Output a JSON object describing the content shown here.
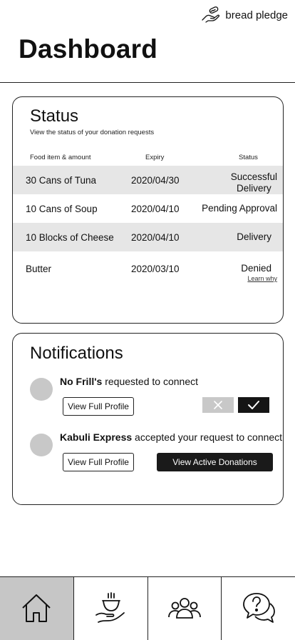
{
  "brand": {
    "name": "bread pledge",
    "icon": "hand-bread-icon"
  },
  "page": {
    "title": "Dashboard"
  },
  "status": {
    "title": "Status",
    "subtitle": "View the status of your donation requests",
    "columns": {
      "food": "Food item & amount",
      "expiry": "Expiry",
      "status": "Status"
    },
    "rows": [
      {
        "food": "30 Cans of Tuna",
        "expiry": "2020/04/30",
        "status_line1": "Successful",
        "status_line2": "Delivery"
      },
      {
        "food": "10 Cans of Soup",
        "expiry": "2020/04/10",
        "status": "Pending Approval"
      },
      {
        "food": "10 Blocks of Cheese",
        "expiry": "2020/04/10",
        "status": "Delivery"
      },
      {
        "food": "Butter",
        "expiry": "2020/03/10",
        "status": "Denied",
        "link": "Learn why"
      }
    ]
  },
  "notifications": {
    "title": "Notifications",
    "items": [
      {
        "org": "No Frill's",
        "message": " requested to connect",
        "profile_button": "View Full Profile",
        "reject_icon": "close-icon",
        "accept_icon": "checkmark-icon"
      },
      {
        "org": "Kabuli Express",
        "message": " accepted your request to connect",
        "profile_button": "View Full Profile",
        "action_button": "View Active Donations"
      }
    ]
  },
  "tabs": [
    {
      "icon": "home-icon",
      "active": true
    },
    {
      "icon": "donate-food-icon",
      "active": false
    },
    {
      "icon": "community-icon",
      "active": false
    },
    {
      "icon": "help-chat-icon",
      "active": false
    }
  ],
  "colors": {
    "shaded_row": "#e6e6e6",
    "avatar": "#c8c8c8",
    "dark_button": "#1a1a1a",
    "active_tab": "#c6c6c6"
  }
}
